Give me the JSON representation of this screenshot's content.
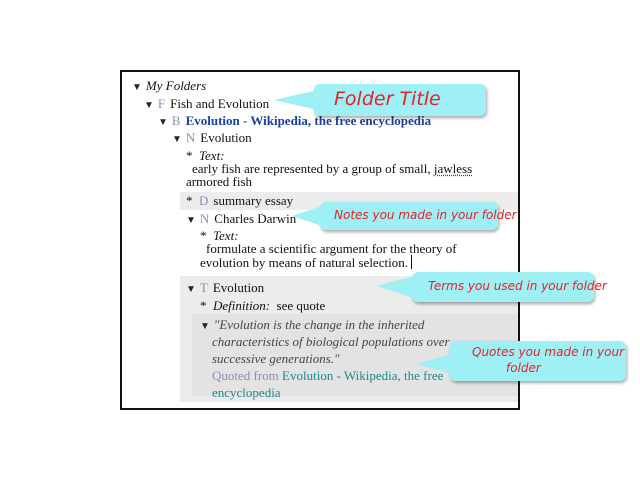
{
  "tree": {
    "root": {
      "toggle": "▼",
      "label": "My Folders"
    },
    "folder": {
      "toggle": "▼",
      "letter": "F",
      "label": "Fish and Evolution"
    },
    "bookmark": {
      "toggle": "▼",
      "letter": "B",
      "label": "Evolution - Wikipedia, the free encyclopedia"
    },
    "note1": {
      "toggle": "▼",
      "letter": "N",
      "label": "Evolution"
    },
    "note1_text": {
      "bullet": "*",
      "label": "Text:",
      "line1": "early fish are represented by a group of small, ",
      "underlined": "jawless",
      "line2": "armored fish"
    },
    "doc": {
      "bullet": "*",
      "letter": "D",
      "label": "summary essay"
    },
    "note2": {
      "toggle": "▼",
      "letter": "N",
      "label": "Charles Darwin"
    },
    "note2_text": {
      "bullet": "*",
      "label": "Text:",
      "line1": "formulate a scientific argument for the theory of",
      "line2": "evolution by means of natural selection."
    },
    "term": {
      "toggle": "▼",
      "letter": "T",
      "label": "Evolution"
    },
    "term_def": {
      "bullet": "*",
      "label": "Definition:",
      "value": "see quote"
    },
    "quote": {
      "toggle": "▼",
      "line1": "\"Evolution is the change in the inherited",
      "line2": "characteristics of biological populations over",
      "line3": "successive generations.\"",
      "source_prefix": "Quoted from ",
      "source_link1": "Evolution - Wikipedia, the free",
      "source_link2": "encyclopedia"
    }
  },
  "callouts": {
    "folder_title": "Folder Title",
    "notes": "Notes you made in your folder",
    "terms": "Terms you used in your folder",
    "quotes_line1": "Quotes you made in your",
    "quotes_line2": "folder"
  },
  "colors": {
    "callout_bg": "#9ff0f5",
    "callout_text": "#e4222a",
    "link_blue": "#1a3fa6",
    "teal": "#1a8a8a"
  }
}
